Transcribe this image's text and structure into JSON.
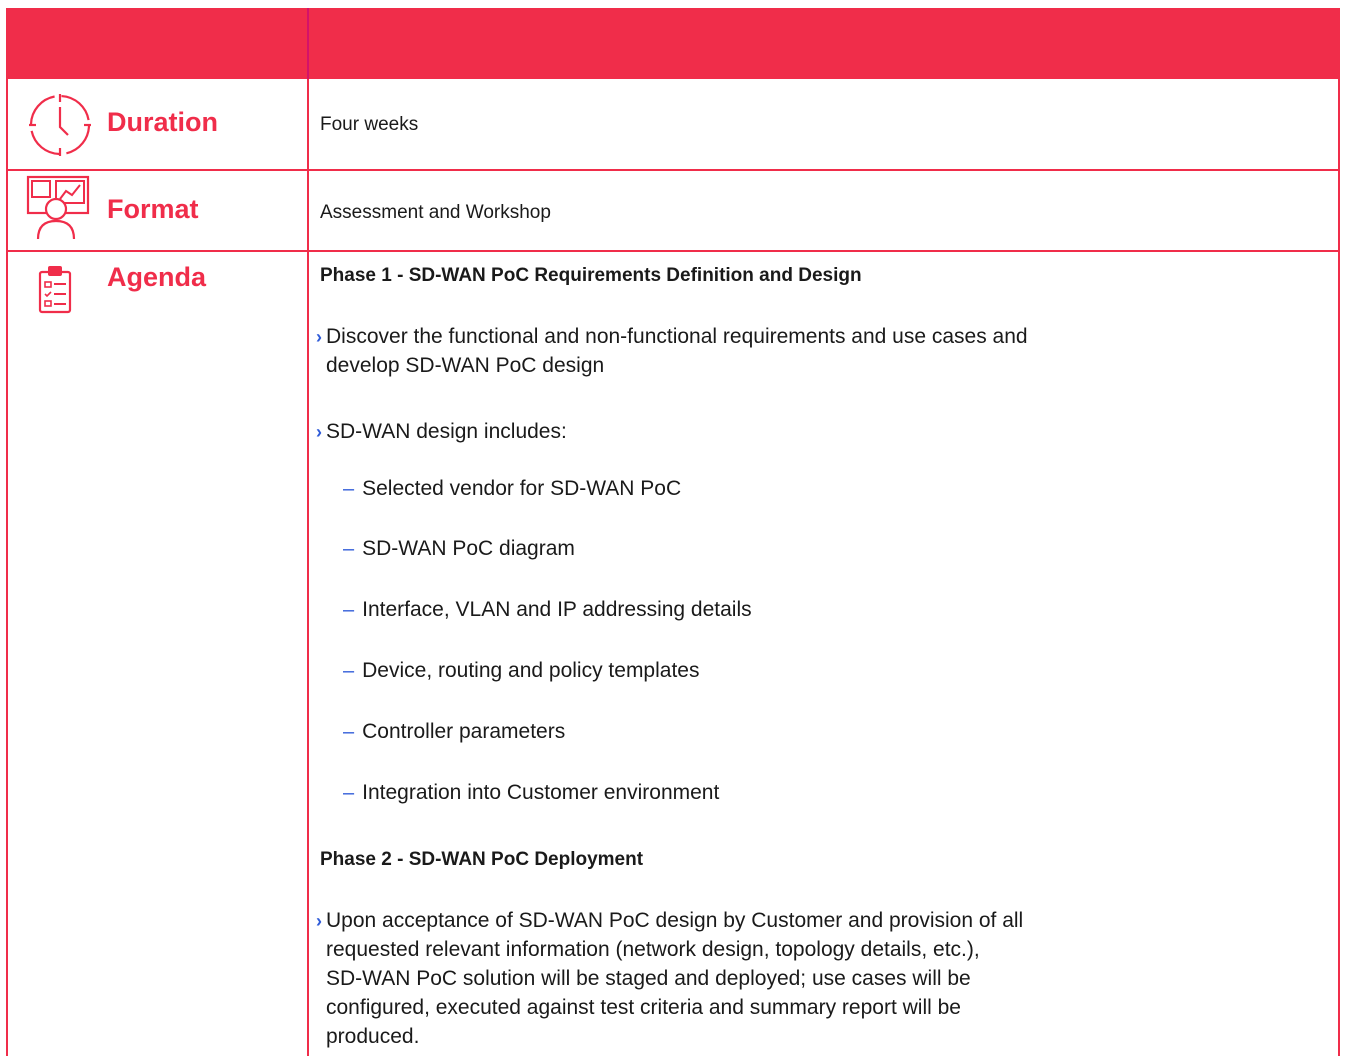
{
  "header": {
    "left": "",
    "right": ""
  },
  "rows": {
    "duration": {
      "label": "Duration",
      "value": "Four weeks",
      "icon": "clock-icon"
    },
    "format": {
      "label": "Format",
      "value": "Assessment and Workshop",
      "icon": "presentation-icon"
    },
    "agenda": {
      "label": "Agenda",
      "icon": "clipboard-checklist-icon"
    }
  },
  "agenda": {
    "phase1": {
      "title": "Phase 1 - SD-WAN PoC Requirements Definition and Design",
      "bullet1_line1": "Discover the functional and non-functional requirements and use cases and",
      "bullet1_line2": "develop SD-WAN PoC design",
      "bullet2": "SD-WAN design includes:",
      "items": [
        "Selected vendor for SD-WAN PoC",
        "SD-WAN PoC diagram",
        "Interface, VLAN and IP addressing details",
        "Device, routing and policy templates",
        "Controller parameters",
        "Integration into Customer environment"
      ]
    },
    "phase2": {
      "title": "Phase 2 - SD-WAN PoC Deployment",
      "bullet_lines": [
        "Upon acceptance of SD-WAN PoC design by Customer and provision of  all",
        "requested relevant information (network design, topology details, etc.),",
        "SD-WAN PoC solution will be staged and deployed; use cases will be",
        "configured,  executed against test criteria and summary report will be",
        "produced."
      ]
    }
  },
  "colors": {
    "accent": "#f02d4a",
    "bullet": "#2f5bd8",
    "header_divider": "#d4126a"
  },
  "symbols": {
    "chevron": "›",
    "dash": "–"
  }
}
